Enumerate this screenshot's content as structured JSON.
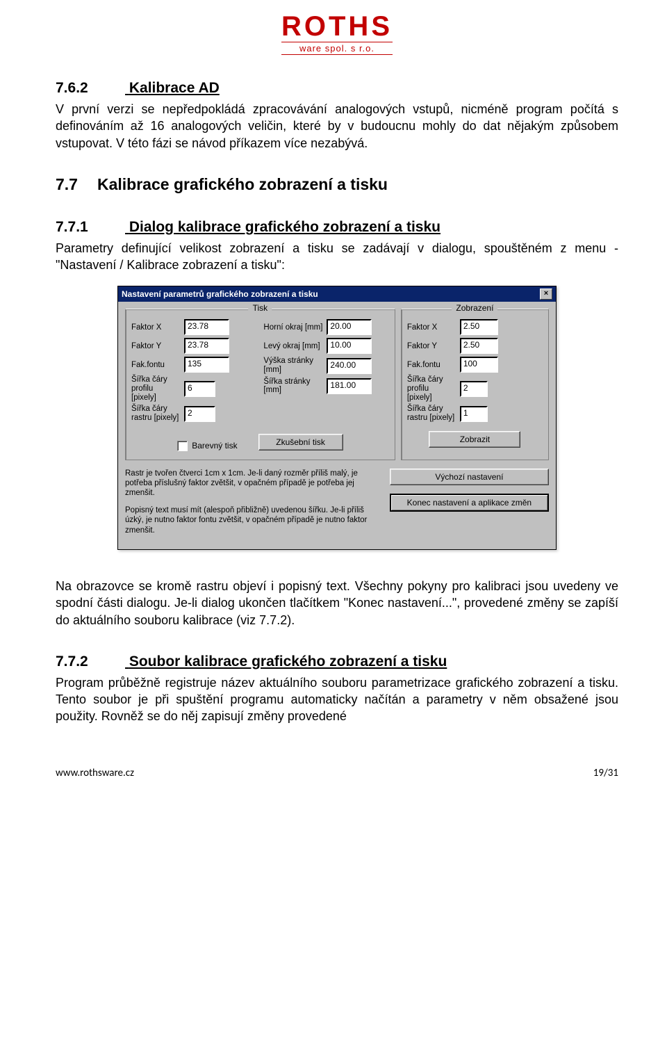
{
  "logo": {
    "main": "ROTHS",
    "sub": "ware spol. s r.o."
  },
  "sec_762": {
    "num": "7.6.2",
    "title": "Kalibrace AD",
    "para": "V první verzi se nepředpokládá zpracovávání analogových vstupů, nicméně program počítá s definováním až 16 analogových veličin, které by v budoucnu mohly do dat nějakým způsobem vstupovat. V této fázi se návod příkazem více nezabývá."
  },
  "sec_77": {
    "num": "7.7",
    "title": "Kalibrace grafického zobrazení a tisku"
  },
  "sec_771": {
    "num": "7.7.1",
    "title": "Dialog kalibrace grafického zobrazení a tisku",
    "para": "Parametry definující velikost zobrazení a tisku se zadávají v dialogu, spouštěném z menu - \"Nastavení / Kalibrace zobrazení a tisku\":"
  },
  "dialog": {
    "title": "Nastavení parametrů grafického zobrazení a tisku",
    "close": "×",
    "tisk": {
      "legend": "Tisk",
      "faktor_x_lbl": "Faktor X",
      "faktor_x": "23.78",
      "faktor_y_lbl": "Faktor Y",
      "faktor_y": "23.78",
      "fak_fontu_lbl": "Fak.fontu",
      "fak_fontu": "135",
      "sirka_prof_lbl": "Šířka čáry profilu [pixely]",
      "sirka_prof": "6",
      "sirka_rastr_lbl": "Šířka čáry rastru [pixely]",
      "sirka_rastr": "2",
      "horni_lbl": "Horní okraj [mm]",
      "horni": "20.00",
      "levy_lbl": "Levý okraj [mm]",
      "levy": "10.00",
      "vyska_lbl": "Výška stránky [mm]",
      "vyska": "240.00",
      "sirka_str_lbl": "Šířka stránky [mm]",
      "sirka_str": "181.00",
      "barevny_lbl": "Barevný tisk",
      "zkusebni_btn": "Zkušební tisk"
    },
    "zobrazeni": {
      "legend": "Zobrazení",
      "faktor_x_lbl": "Faktor X",
      "faktor_x": "2.50",
      "faktor_y_lbl": "Faktor Y",
      "faktor_y": "2.50",
      "fak_fontu_lbl": "Fak.fontu",
      "fak_fontu": "100",
      "sirka_prof_lbl": "Šířka čáry profilu [pixely]",
      "sirka_prof": "2",
      "sirka_rastr_lbl": "Šířka čáry rastru [pixely]",
      "sirka_rastr": "1",
      "zobrazit_btn": "Zobrazit"
    },
    "note1": "Rastr je tvořen čtverci 1cm x 1cm. Je-li daný rozměr příliš malý, je potřeba příslušný faktor zvětšit, v opačném případě je potřeba jej zmenšit.",
    "note2": "Popisný text musí mít (alespoň přibližně) uvedenou šířku. Je-li příliš úzký, je nutno faktor fontu zvětšit, v opačném případě je nutno faktor zmenšit.",
    "btn_vychozi": "Výchozí nastavení",
    "btn_konec": "Konec nastavení a aplikace změn"
  },
  "after_dialog": "Na obrazovce se kromě rastru objeví i popisný text. Všechny pokyny pro kalibraci jsou uvedeny ve spodní části dialogu. Je-li dialog ukončen tlačítkem \"Konec nastavení...\", provedené změny se zapíší do aktuálního souboru kalibrace (viz 7.7.2).",
  "sec_772": {
    "num": "7.7.2",
    "title": "Soubor kalibrace grafického zobrazení a tisku",
    "para": "Program průběžně registruje název aktuálního souboru parametrizace grafického zobrazení a tisku. Tento soubor je při spuštění programu automaticky načítán a parametry v něm obsažené jsou použity. Rovněž se do něj zapisují změny provedené"
  },
  "footer": {
    "left": "www.rothsware.cz",
    "right": "19/31"
  }
}
